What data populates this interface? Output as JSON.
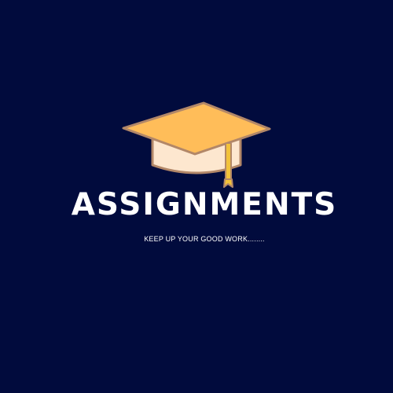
{
  "logo": {
    "icon": "graduation-cap-icon",
    "title": "ASSIGNMENTS",
    "tagline": "KEEP UP YOUR GOOD WORK........"
  },
  "colors": {
    "background": "#010b3d",
    "cap_top": "#ffbd59",
    "cap_base": "#fde7cf",
    "cap_outline": "#b28768",
    "tassel": "#f2c23a",
    "text": "#ffffff"
  }
}
